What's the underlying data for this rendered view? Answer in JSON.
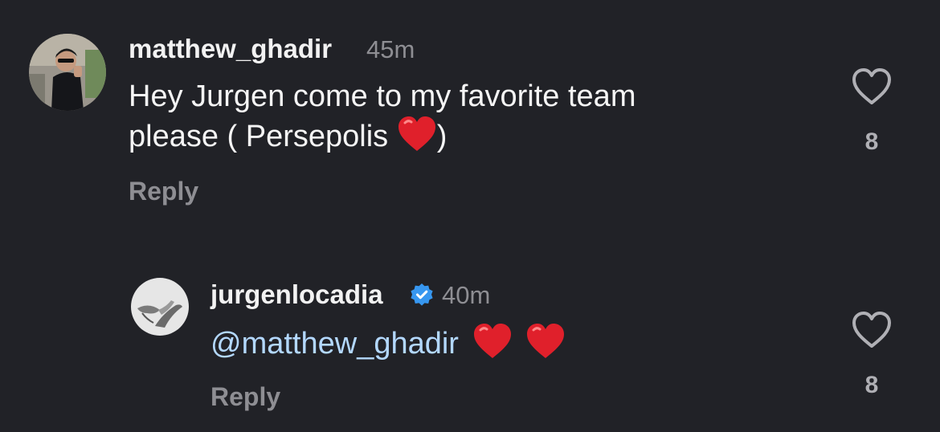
{
  "comments": [
    {
      "username": "matthew_ghadir",
      "time": "45m",
      "text_line1": "Hey Jurgen come to my favorite team",
      "text_line2_prefix": "please ( Persepolis ",
      "text_line2_suffix": ")",
      "reply_label": "Reply",
      "like_count": "8",
      "avatar_icon": "profile-photo-man-sunglasses"
    },
    {
      "username": "jurgenlocadia",
      "verified": true,
      "time": "40m",
      "mention": "@matthew_ghadir",
      "reply_label": "Reply",
      "like_count": "8",
      "avatar_icon": "profile-photo-hands"
    }
  ],
  "colors": {
    "background": "#212227",
    "secondary_text": "#8e8e93",
    "mention": "#b3d8ff",
    "verified_badge": "#3797f0",
    "heart_emoji": "#e0202b"
  },
  "icons": {
    "like": "heart-outline-icon",
    "verified": "verified-badge-icon",
    "emoji": "red-heart-emoji"
  }
}
